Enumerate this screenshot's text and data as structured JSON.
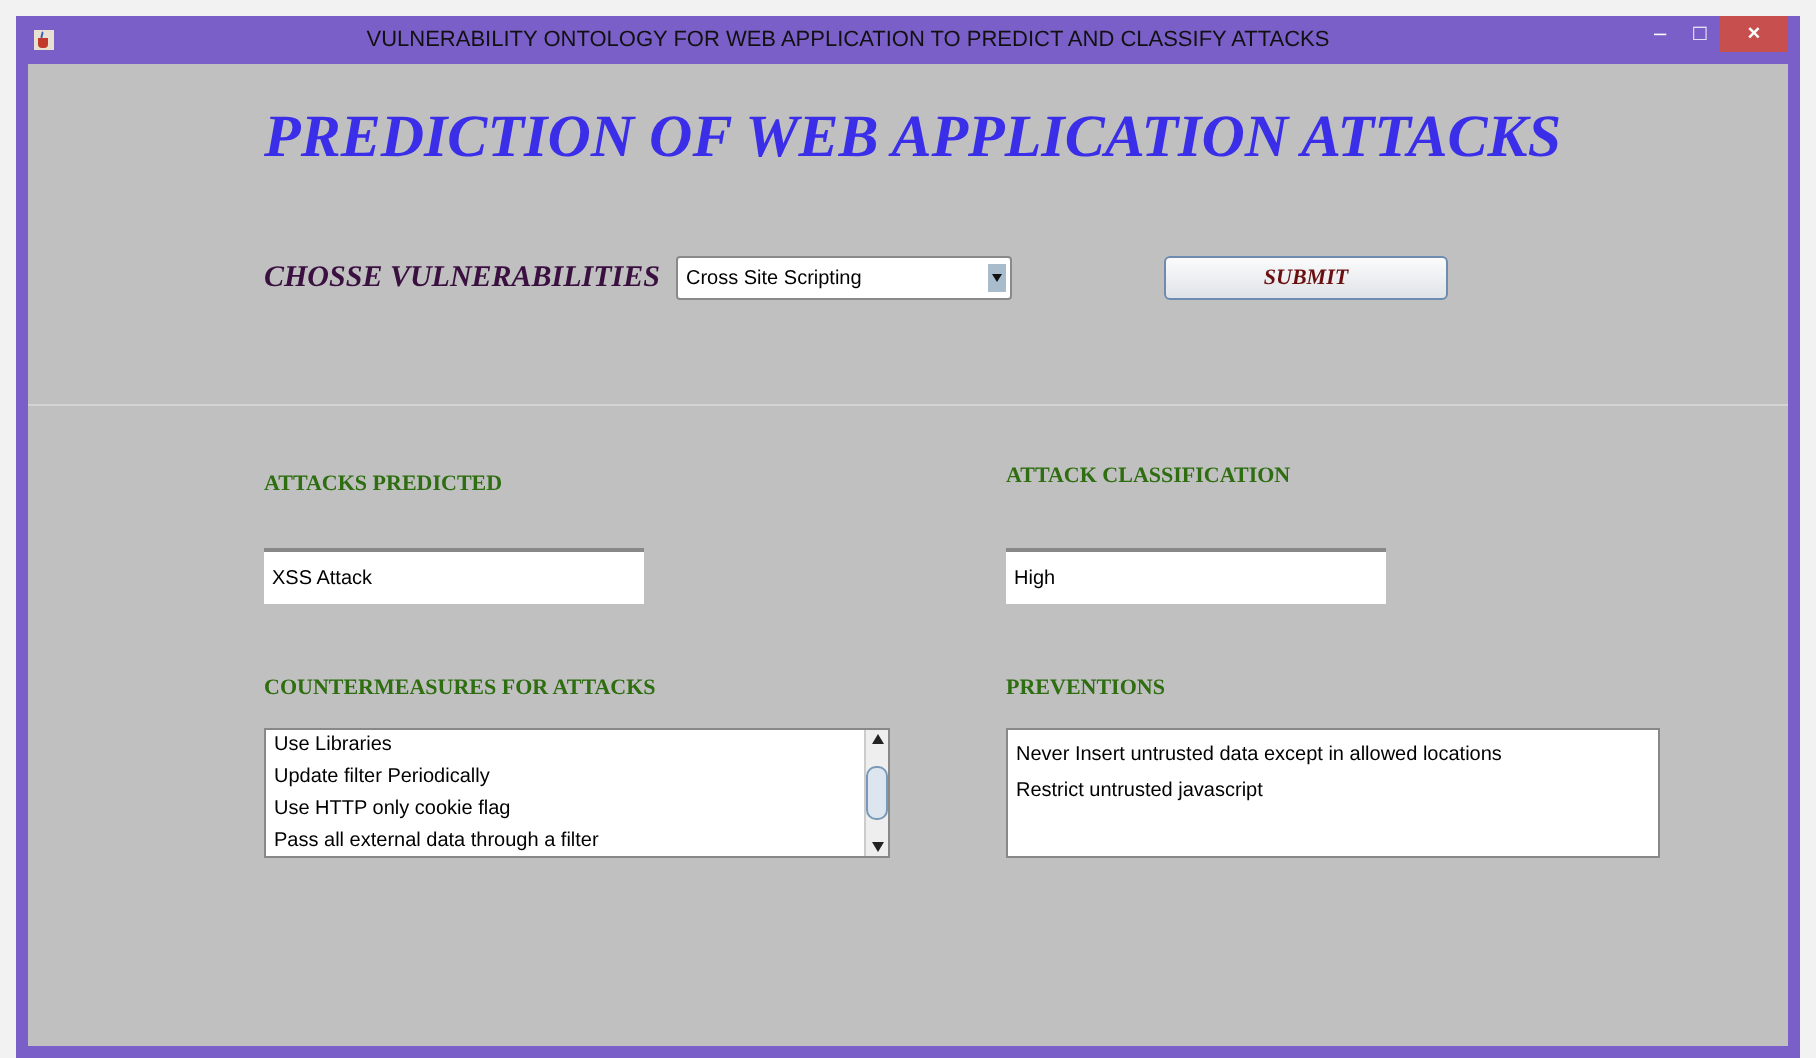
{
  "window": {
    "title": "VULNERABILITY ONTOLOGY FOR WEB APPLICATION TO PREDICT AND CLASSIFY ATTACKS",
    "controls": [
      "–",
      "□",
      "×"
    ]
  },
  "heading": "PREDICTION OF WEB APPLICATION ATTACKS",
  "vulnerability": {
    "label": "CHOSSE VULNERABILITIES",
    "value": "Cross Site Scripting"
  },
  "submit": "SUBMIT",
  "attacks_predicted": {
    "label": "ATTACKS PREDICTED",
    "value": "XSS Attack"
  },
  "attack_classification": {
    "label": "ATTACK CLASSIFICATION",
    "value": "High"
  },
  "countermeasures": {
    "label": "COUNTERMEASURES FOR ATTACKS",
    "items": [
      "Use Libraries",
      "Update filter Periodically",
      "Use HTTP only cookie flag",
      "Pass all external data through a filter"
    ]
  },
  "preventions": {
    "label": "PREVENTIONS",
    "items": [
      "Never Insert untrusted data except in allowed locations",
      "Restrict untrusted javascript"
    ]
  }
}
